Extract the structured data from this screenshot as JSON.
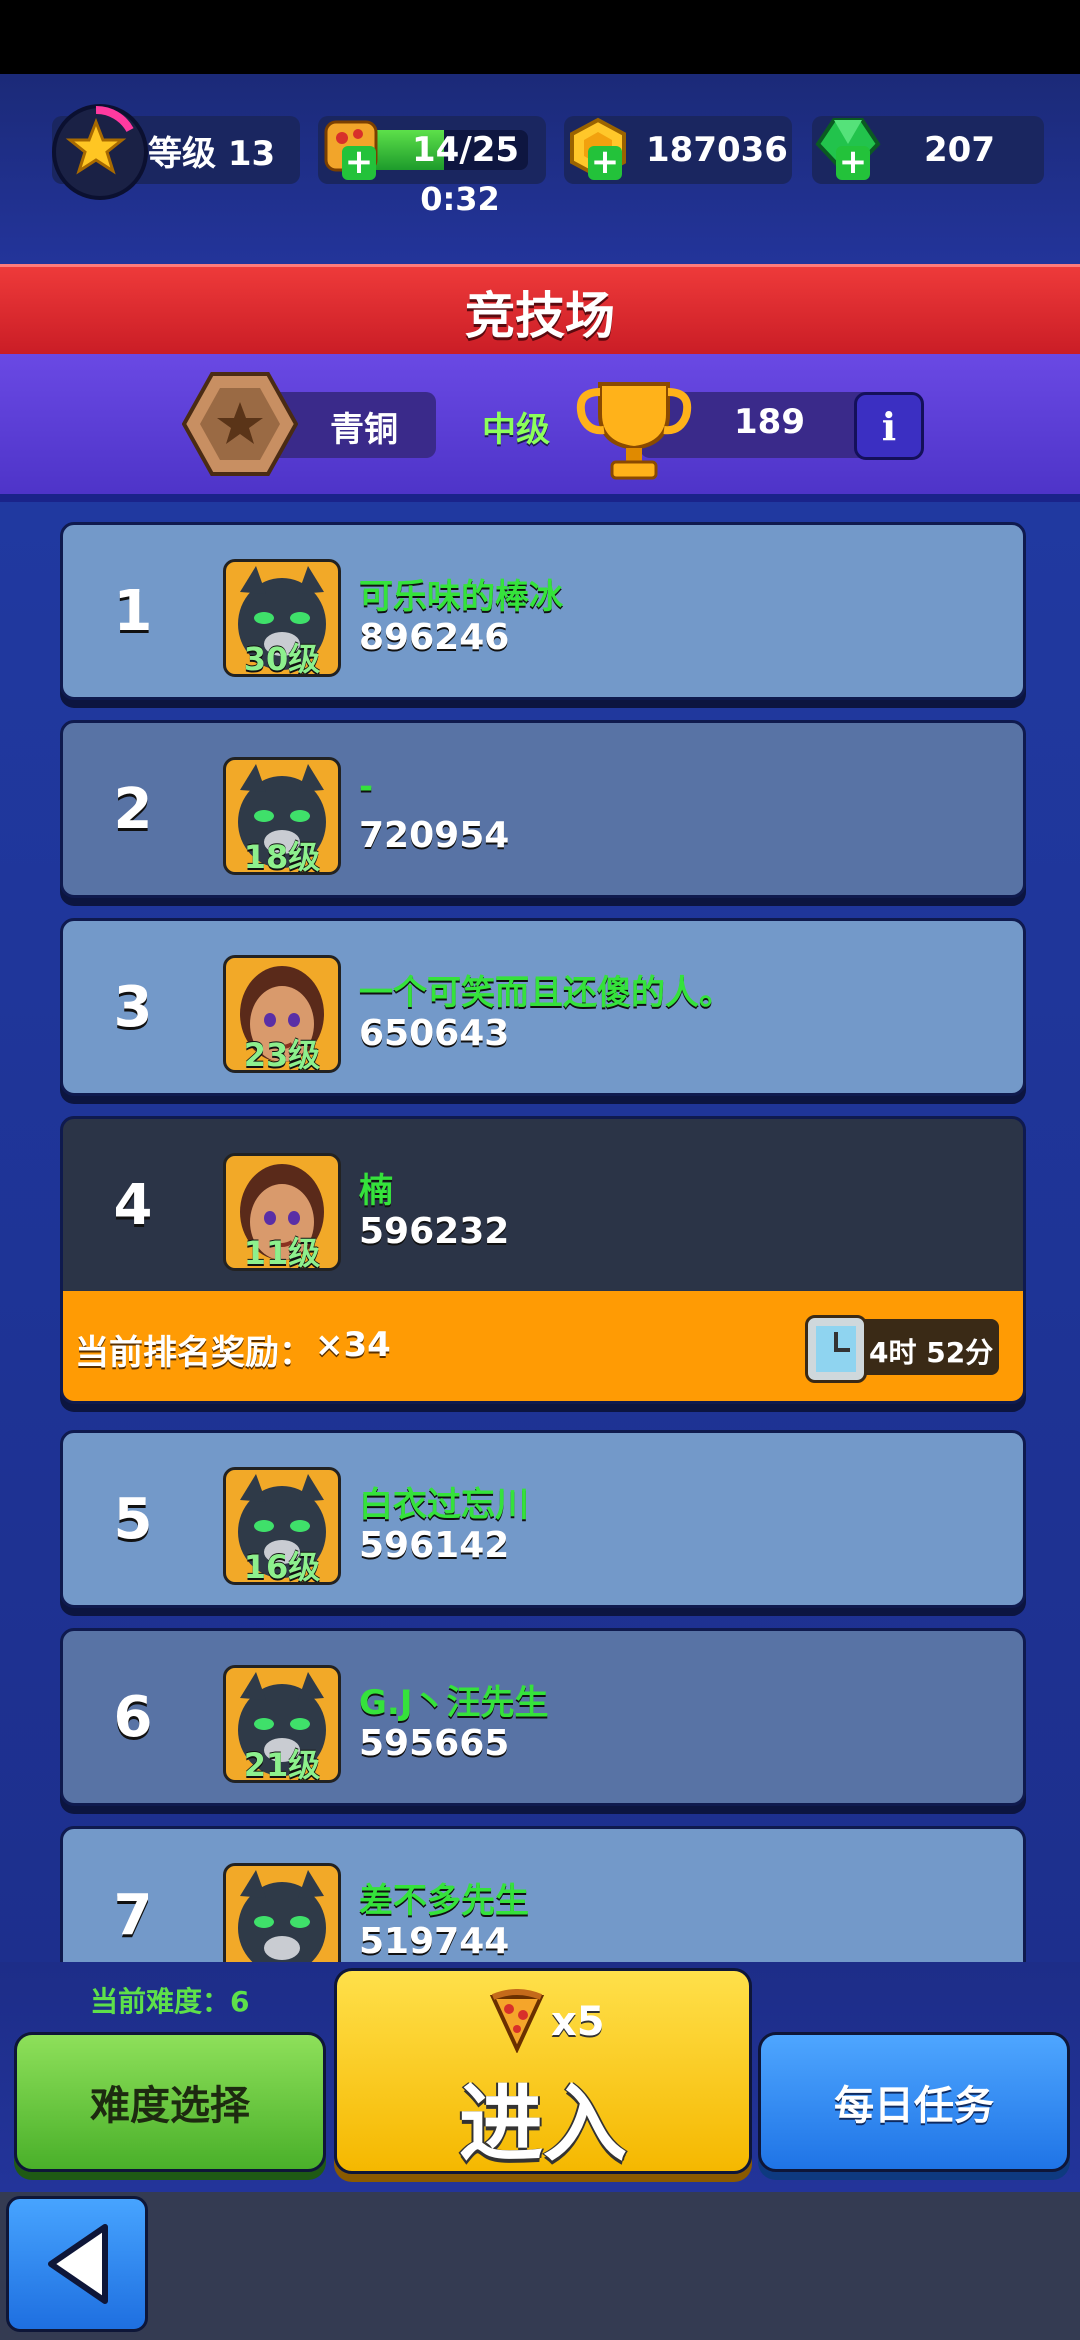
{
  "status": {
    "level": "等级 13",
    "energy": "14/25",
    "energy_fill": 0.56,
    "energy_timer": "0:32",
    "coins": "187036",
    "gems": "207"
  },
  "title": "竞技场",
  "rank_info": {
    "tier": "青铜",
    "division": "中级",
    "trophies": "189",
    "info_glyph": "i"
  },
  "players": [
    {
      "rank": "1",
      "name": "可乐味的棒冰",
      "score": "896246",
      "level": "30级",
      "avatar": "panther-avatar"
    },
    {
      "rank": "2",
      "name": "-",
      "score": "720954",
      "level": "18级",
      "avatar": "panther-avatar"
    },
    {
      "rank": "3",
      "name": "一个可笑而且还傻的人。",
      "score": "650643",
      "level": "23级",
      "avatar": "woman-avatar"
    },
    {
      "rank": "4",
      "name": "楠",
      "score": "596232",
      "level": "11级",
      "avatar": "woman-avatar"
    },
    {
      "rank": "5",
      "name": "白衣过忘川",
      "score": "596142",
      "level": "16级",
      "avatar": "panther-avatar"
    },
    {
      "rank": "6",
      "name": "G.J丶汪先生",
      "score": "595665",
      "level": "21级",
      "avatar": "panther-avatar"
    },
    {
      "rank": "7",
      "name": "差不多先生",
      "score": "519744",
      "level": "",
      "avatar": "panther-avatar"
    }
  ],
  "reward": {
    "label": "当前排名奖励：",
    "amount": "×34",
    "time_left": "4时 52分"
  },
  "bottom": {
    "difficulty": "当前难度：6",
    "difficulty_button": "难度选择",
    "enter_cost": "x5",
    "enter_button": "进入",
    "daily_button": "每日任务"
  },
  "icons": {
    "level": "star-icon",
    "energy": "pizza-icon",
    "coins": "coin-icon",
    "gems": "gem-icon",
    "tier": "bronze-badge-icon",
    "trophy": "trophy-icon",
    "info": "info-icon",
    "timer": "clock-icon",
    "back": "back-arrow-icon"
  },
  "colors": {
    "title_red": "#e32c2f",
    "rank_purple": "#5d3fd6",
    "player_name_green": "#35e23b",
    "reward_orange": "#ff9b04",
    "enter_yellow": "#f9c300",
    "difficulty_green": "#6acc44",
    "daily_blue": "#2f86f4"
  }
}
